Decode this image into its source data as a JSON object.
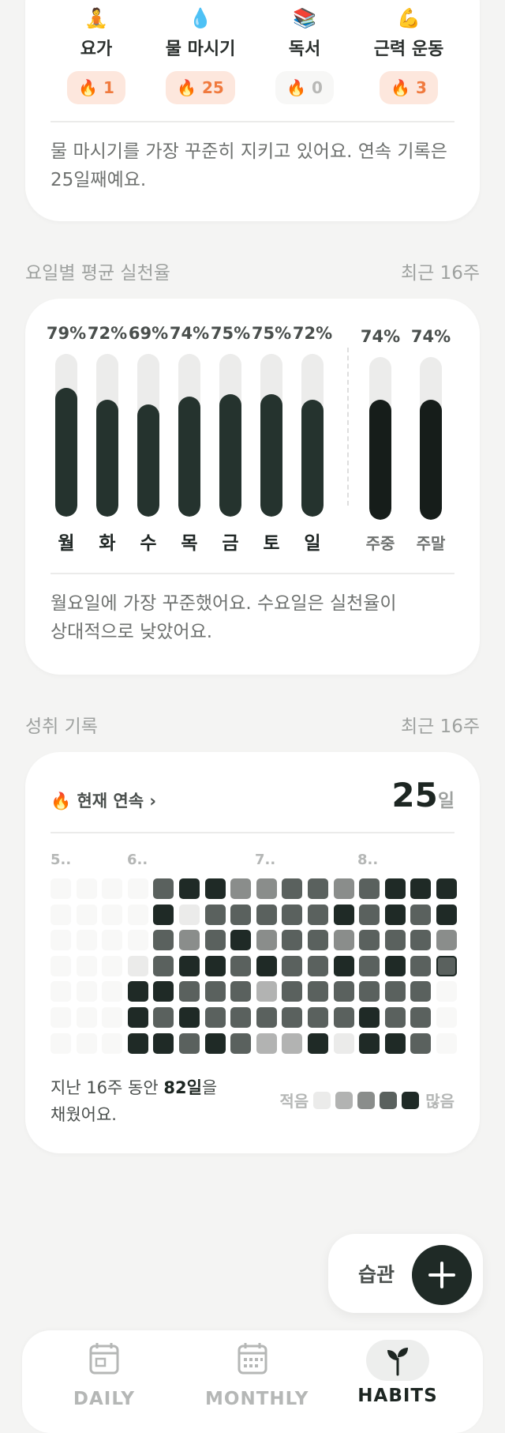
{
  "streaks": {
    "habits": [
      {
        "emoji": "🧘",
        "name": "요가",
        "streak": "🔥 1",
        "zero": false
      },
      {
        "emoji": "💧",
        "name": "물 마시기",
        "streak": "🔥 25",
        "zero": false
      },
      {
        "emoji": "📚",
        "name": "독서",
        "streak": "🔥 0",
        "zero": true
      },
      {
        "emoji": "💪",
        "name": "근력 운동",
        "streak": "🔥 3",
        "zero": false
      }
    ],
    "summary": "물 마시기를 가장 꾸준히 지키고 있어요. 연속 기록은 25일째예요."
  },
  "weekday": {
    "title": "요일별 평균 실천율",
    "range": "최근 16주",
    "days": [
      {
        "label": "월",
        "pct": "79%",
        "value": 0.79
      },
      {
        "label": "화",
        "pct": "72%",
        "value": 0.72
      },
      {
        "label": "수",
        "pct": "69%",
        "value": 0.69
      },
      {
        "label": "목",
        "pct": "74%",
        "value": 0.74
      },
      {
        "label": "금",
        "pct": "75%",
        "value": 0.75
      },
      {
        "label": "토",
        "pct": "75%",
        "value": 0.75
      },
      {
        "label": "일",
        "pct": "72%",
        "value": 0.72
      }
    ],
    "groups": [
      {
        "label": "주중",
        "pct": "74%",
        "value": 0.74
      },
      {
        "label": "주말",
        "pct": "74%",
        "value": 0.74
      }
    ],
    "summary_line1": "월요일에 가장 꾸준했어요. 수요일은 실천율이",
    "summary_line2": "상대적으로 낮았어요."
  },
  "achievement": {
    "title": "성취 기록",
    "range": "최근 16주",
    "current_label": "🔥 현재 연속 ›",
    "current_value": "25",
    "current_unit": "일",
    "months": [
      "5..",
      "6..",
      "7..",
      "8.."
    ],
    "summary_pre": "지난 16주 동안 ",
    "summary_bold": "82일",
    "summary_post": "을",
    "summary_line2": "채웠어요.",
    "legend_less": "적음",
    "legend_more": "많음",
    "legend_levels": [
      1,
      2,
      3,
      4,
      5
    ],
    "level_colors": [
      "#f8f8f7",
      "#ebebea",
      "#b2b3b2",
      "#8a8d8b",
      "#5a615e",
      "#1f2a26"
    ],
    "grid": [
      [
        0,
        0,
        0,
        0,
        4,
        5,
        5,
        3,
        3,
        4,
        4,
        3,
        4,
        5,
        5,
        5
      ],
      [
        0,
        0,
        0,
        0,
        5,
        1,
        4,
        4,
        4,
        4,
        4,
        5,
        4,
        5,
        4,
        5
      ],
      [
        0,
        0,
        0,
        0,
        4,
        3,
        4,
        5,
        3,
        4,
        4,
        3,
        4,
        4,
        4,
        3
      ],
      [
        0,
        0,
        0,
        1,
        4,
        5,
        5,
        4,
        5,
        4,
        4,
        5,
        4,
        5,
        4,
        9
      ],
      [
        0,
        0,
        0,
        5,
        5,
        4,
        4,
        4,
        2,
        4,
        4,
        4,
        4,
        4,
        4,
        0
      ],
      [
        0,
        0,
        0,
        5,
        4,
        5,
        4,
        4,
        4,
        4,
        4,
        4,
        5,
        4,
        4,
        0
      ],
      [
        0,
        0,
        0,
        5,
        5,
        4,
        5,
        4,
        2,
        2,
        5,
        1,
        5,
        5,
        4,
        0
      ]
    ]
  },
  "fab": {
    "label": "습관",
    "icon": "plus-icon"
  },
  "nav": {
    "items": [
      {
        "label": "DAILY",
        "icon": "calendar-day-icon"
      },
      {
        "label": "MONTHLY",
        "icon": "calendar-month-icon"
      },
      {
        "label": "HABITS",
        "icon": "sprout-icon"
      }
    ]
  },
  "colors": {
    "accent": "#1f2a26",
    "streak": "#f07a3e",
    "streak_bg": "#fde7dd"
  }
}
